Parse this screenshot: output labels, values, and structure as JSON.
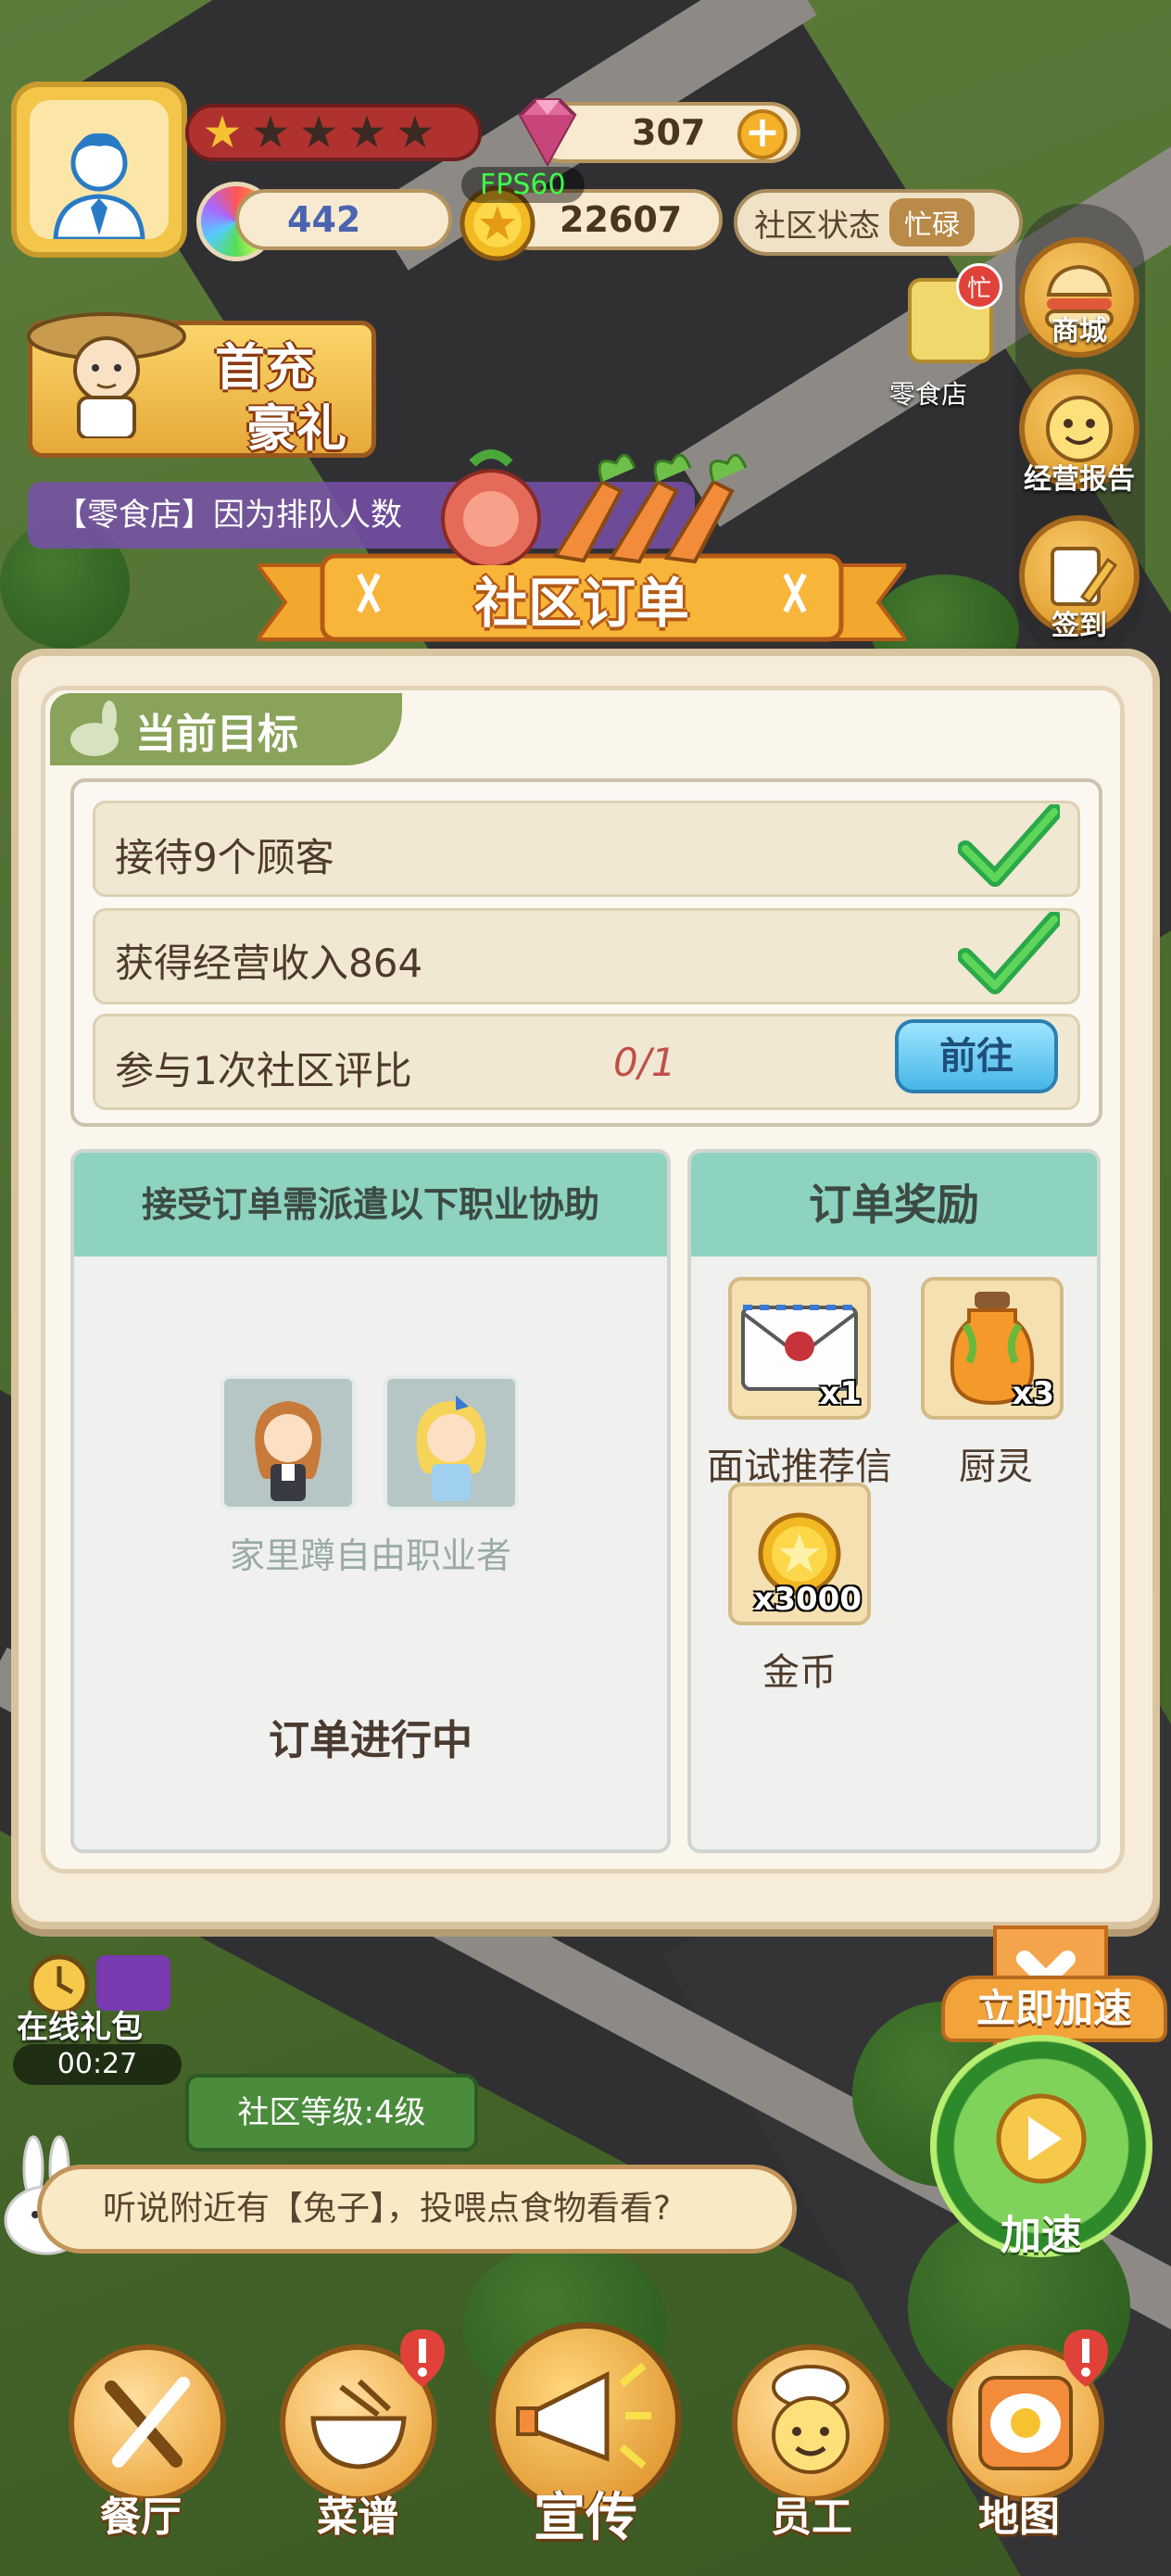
{
  "hud": {
    "gems": "307",
    "rainbow": "442",
    "fps": "FPS60",
    "coins": "22607",
    "status_label": "社区状态",
    "status_value": "忙碌",
    "stars_total": 5,
    "stars_filled": 1
  },
  "side_menu": {
    "shop_small_label": "零食店",
    "shop_small_badge": "忙",
    "items": [
      {
        "label": "商城"
      },
      {
        "label": "经营报告"
      },
      {
        "label": "签到"
      }
    ]
  },
  "promo": {
    "line1": "首充",
    "line2": "豪礼"
  },
  "notice": {
    "text": "【零食店】因为排队人数"
  },
  "dialog": {
    "title": "社区订单",
    "goal_tab": "当前目标",
    "goals": [
      {
        "text": "接待9个顾客",
        "done": true
      },
      {
        "text": "获得经营收入864",
        "done": true
      },
      {
        "text": "参与1次社区评比",
        "done": false,
        "progress": "0/1",
        "action": "前往"
      }
    ],
    "job_panel": {
      "heading": "接受订单需派遣以下职业协助",
      "job_name": "家里蹲自由职业者",
      "status": "订单进行中"
    },
    "reward_panel": {
      "heading": "订单奖励",
      "rewards": [
        {
          "name": "面试推荐信",
          "qty": "x1",
          "icon": "envelope-icon"
        },
        {
          "name": "厨灵",
          "qty": "x3",
          "icon": "jar-icon"
        },
        {
          "name": "金币",
          "qty": "x3000",
          "icon": "coin-icon"
        }
      ]
    }
  },
  "bottom": {
    "online_gift": "在线礼包",
    "timer": "00:27",
    "level": "社区等级:4级",
    "hint": "听说附近有【兔子】，投喂点食物看看?",
    "speed_top": "立即加速",
    "speed_label": "加速",
    "nav": [
      {
        "label": "餐厅"
      },
      {
        "label": "菜谱"
      },
      {
        "label": "宣传"
      },
      {
        "label": "员工"
      },
      {
        "label": "地图"
      }
    ]
  }
}
